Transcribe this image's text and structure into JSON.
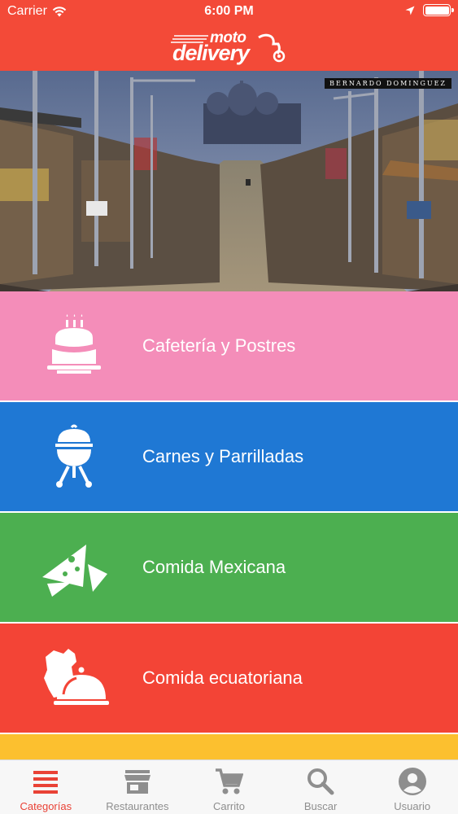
{
  "status_bar": {
    "carrier": "Carrier",
    "time": "6:00 PM"
  },
  "header": {
    "logo_top": "moto",
    "logo_bottom": "delivery",
    "color": "#f34a38"
  },
  "hero": {
    "photo_credit": "BERNARDO DOMINGUEZ"
  },
  "categories": [
    {
      "label": "Cafetería y Postres",
      "color": "#f48db9",
      "icon": "cake-icon"
    },
    {
      "label": "Carnes y Parrilladas",
      "color": "#1f78d4",
      "icon": "grill-icon"
    },
    {
      "label": "Comida Mexicana",
      "color": "#4caf50",
      "icon": "nachos-icon"
    },
    {
      "label": "Comida ecuatoriana",
      "color": "#f34436",
      "icon": "cloche-icon"
    },
    {
      "label": "",
      "color": "#fcc02f",
      "icon": ""
    }
  ],
  "tabbar": {
    "active_color": "#e94236",
    "tabs": [
      {
        "label": "Categorías",
        "icon": "list-icon",
        "active": true
      },
      {
        "label": "Restaurantes",
        "icon": "store-icon",
        "active": false
      },
      {
        "label": "Carrito",
        "icon": "cart-icon",
        "active": false
      },
      {
        "label": "Buscar",
        "icon": "search-icon",
        "active": false
      },
      {
        "label": "Usuario",
        "icon": "user-icon",
        "active": false
      }
    ]
  }
}
